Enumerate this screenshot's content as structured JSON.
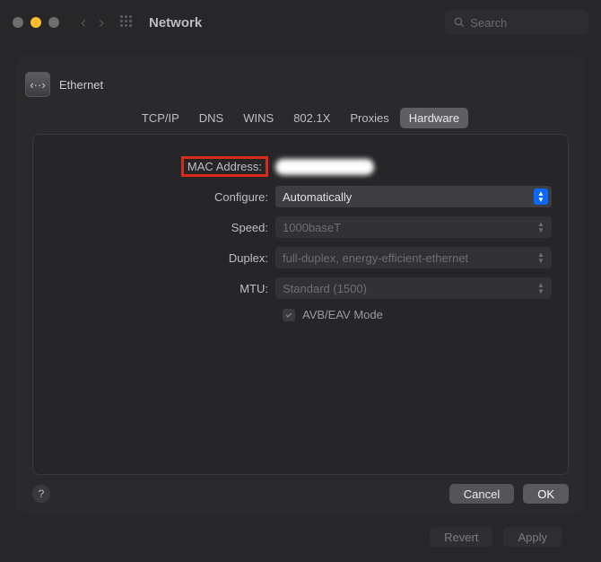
{
  "toolbar": {
    "title": "Network",
    "search_placeholder": "Search"
  },
  "sheet": {
    "interface_icon_glyph": "‹··›",
    "interface_name": "Ethernet",
    "tabs": [
      "TCP/IP",
      "DNS",
      "WINS",
      "802.1X",
      "Proxies",
      "Hardware"
    ],
    "active_tab": "Hardware",
    "form": {
      "mac_address_label": "MAC Address:",
      "mac_address_value": "",
      "configure_label": "Configure:",
      "configure_value": "Automatically",
      "speed_label": "Speed:",
      "speed_value": "1000baseT",
      "duplex_label": "Duplex:",
      "duplex_value": "full-duplex, energy-efficient-ethernet",
      "mtu_label": "MTU:",
      "mtu_value": "Standard  (1500)",
      "avb_label": "AVB/EAV Mode",
      "avb_checked": true
    },
    "buttons": {
      "help": "?",
      "cancel": "Cancel",
      "ok": "OK"
    }
  },
  "footer": {
    "revert": "Revert",
    "apply": "Apply"
  },
  "annotation": {
    "mac_address_highlight_color": "#d92a1c"
  }
}
